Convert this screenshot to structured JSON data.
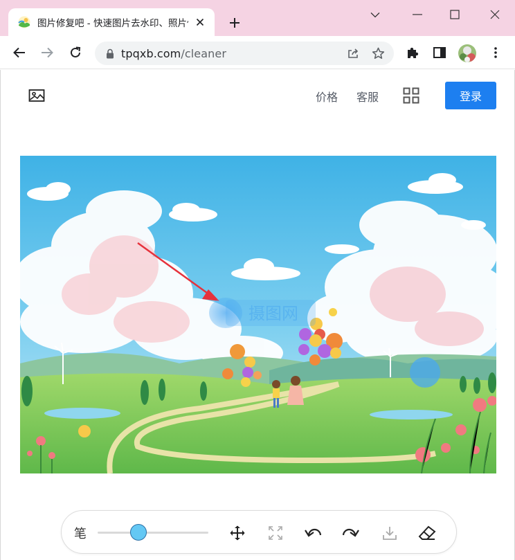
{
  "browser": {
    "tab_title": "图片修复吧 - 快速图片去水印、照片修复",
    "url_domain": "tpqxb.com",
    "url_path": "/cleaner",
    "icons": [
      "image-favicon",
      "close-icon",
      "plus-icon",
      "chevron-down-icon",
      "minimize-icon",
      "maximize-icon",
      "close-window-icon",
      "back-arrow-icon",
      "forward-arrow-icon",
      "reload-icon",
      "lock-icon",
      "share-icon",
      "star-icon",
      "extensions-puzzle-icon",
      "side-panel-icon",
      "profile-avatar",
      "more-menu-icon"
    ]
  },
  "site": {
    "nav": {
      "price": "价格",
      "service": "客服",
      "login": "登录"
    },
    "icons": [
      "picture-logo-icon",
      "apps-grid-icon"
    ]
  },
  "canvas": {
    "watermark_text": "摄图网",
    "description_icons": [
      "red-arrow-annotation",
      "blue-watermark-mark"
    ]
  },
  "tools": {
    "pen_label": "笔",
    "brush_size": 0.37,
    "icons": [
      "move-icon",
      "fullscreen-icon",
      "undo-icon",
      "redo-icon",
      "download-icon",
      "eraser-icon"
    ]
  },
  "colors": {
    "tabstrip": "#f5d3e3",
    "accent": "#1d7ff0",
    "slider_thumb": "#64c8f4"
  }
}
